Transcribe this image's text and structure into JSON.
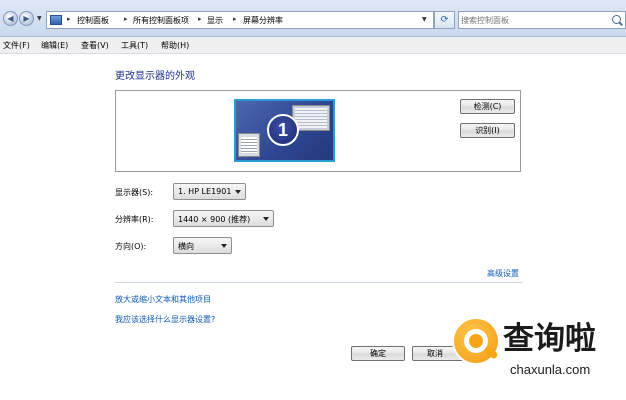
{
  "address_bar": {
    "breadcrumbs": [
      "控制面板",
      "所有控制面板项",
      "显示",
      "屏幕分辨率"
    ],
    "search_placeholder": "搜索控制面板"
  },
  "menubar": {
    "items": [
      "文件(F)",
      "编辑(E)",
      "查看(V)",
      "工具(T)",
      "帮助(H)"
    ]
  },
  "main": {
    "title": "更改显示器的外观",
    "monitor_number": "1",
    "detect_label": "检测(C)",
    "identify_label": "识别(I)",
    "display_label": "显示器(S):",
    "display_value": "1. HP LE1901",
    "resolution_label": "分辨率(R):",
    "resolution_value": "1440 × 900 (推荐)",
    "orientation_label": "方向(O):",
    "orientation_value": "横向",
    "advanced_link": "高级设置",
    "text_size_link": "放大或缩小文本和其他项目",
    "which_settings_link": "我应该选择什么显示器设置?"
  },
  "footer": {
    "ok_label": "确定",
    "cancel_label": "取消"
  },
  "watermark": {
    "brand": "查询啦",
    "domain": "chaxunla.com"
  },
  "colors": {
    "title": "#1e3287",
    "link": "#0f5ab8",
    "monitor_border": "#2b9bd6",
    "watermark_orange": "#f5a516"
  },
  "icons": {
    "back": "back-arrow-icon",
    "forward": "forward-arrow-icon",
    "control_panel": "control-panel-icon",
    "refresh": "refresh-icon",
    "search": "search-icon"
  }
}
